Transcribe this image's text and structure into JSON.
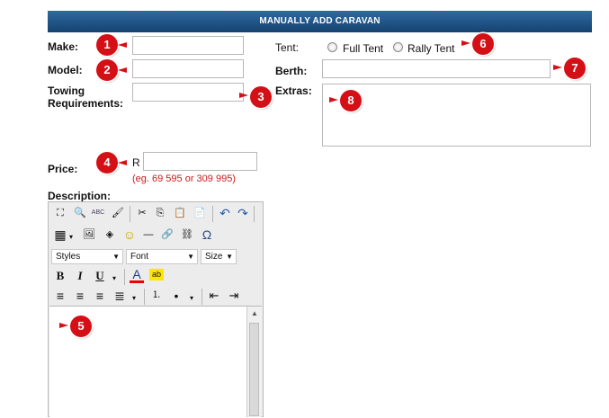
{
  "header": {
    "title": "MANUALLY ADD CARAVAN"
  },
  "form": {
    "make_label": "Make:",
    "model_label": "Model:",
    "towing_label_1": "Towing",
    "towing_label_2": "Requirements:",
    "price_label": "Price:",
    "currency": "R",
    "price_hint": "(eg. 69 595 or 309 995)",
    "description_label": "Description:",
    "tent_label": "Tent:",
    "tent_options": [
      "Full Tent",
      "Rally Tent"
    ],
    "berth_label": "Berth:",
    "extras_label": "Extras:"
  },
  "callouts": [
    "1",
    "2",
    "3",
    "4",
    "5",
    "6",
    "7",
    "8"
  ],
  "editor": {
    "styles_label": "Styles",
    "font_label": "Font",
    "size_label": "Size",
    "icons": {
      "maximize": "⛶",
      "find": "🔍",
      "spellcheck": "ABC",
      "cleanup": "🖌",
      "cut": "✂",
      "copy": "⎘",
      "paste": "📋",
      "paste_word": "📄",
      "undo": "↶",
      "redo": "↷",
      "table": "▦",
      "image": "🖼",
      "anchor": "◈",
      "smiley": "☺",
      "hr": "—",
      "link": "🔗",
      "unlink": "⛓",
      "special_char": "Ω",
      "bold": "B",
      "italic": "I",
      "underline": "U",
      "font_color": "A",
      "highlight": "ab",
      "align_left": "≡",
      "align_center": "≡",
      "align_right": "≡",
      "justify": "≣",
      "ordered_list": "⒈",
      "unordered_list": "•",
      "outdent": "⇤",
      "indent": "⇥"
    }
  },
  "colors": {
    "header_top": "#2e6aa3",
    "header_bottom": "#16426f",
    "callout": "#d41016",
    "hint": "#cc1b1b"
  }
}
